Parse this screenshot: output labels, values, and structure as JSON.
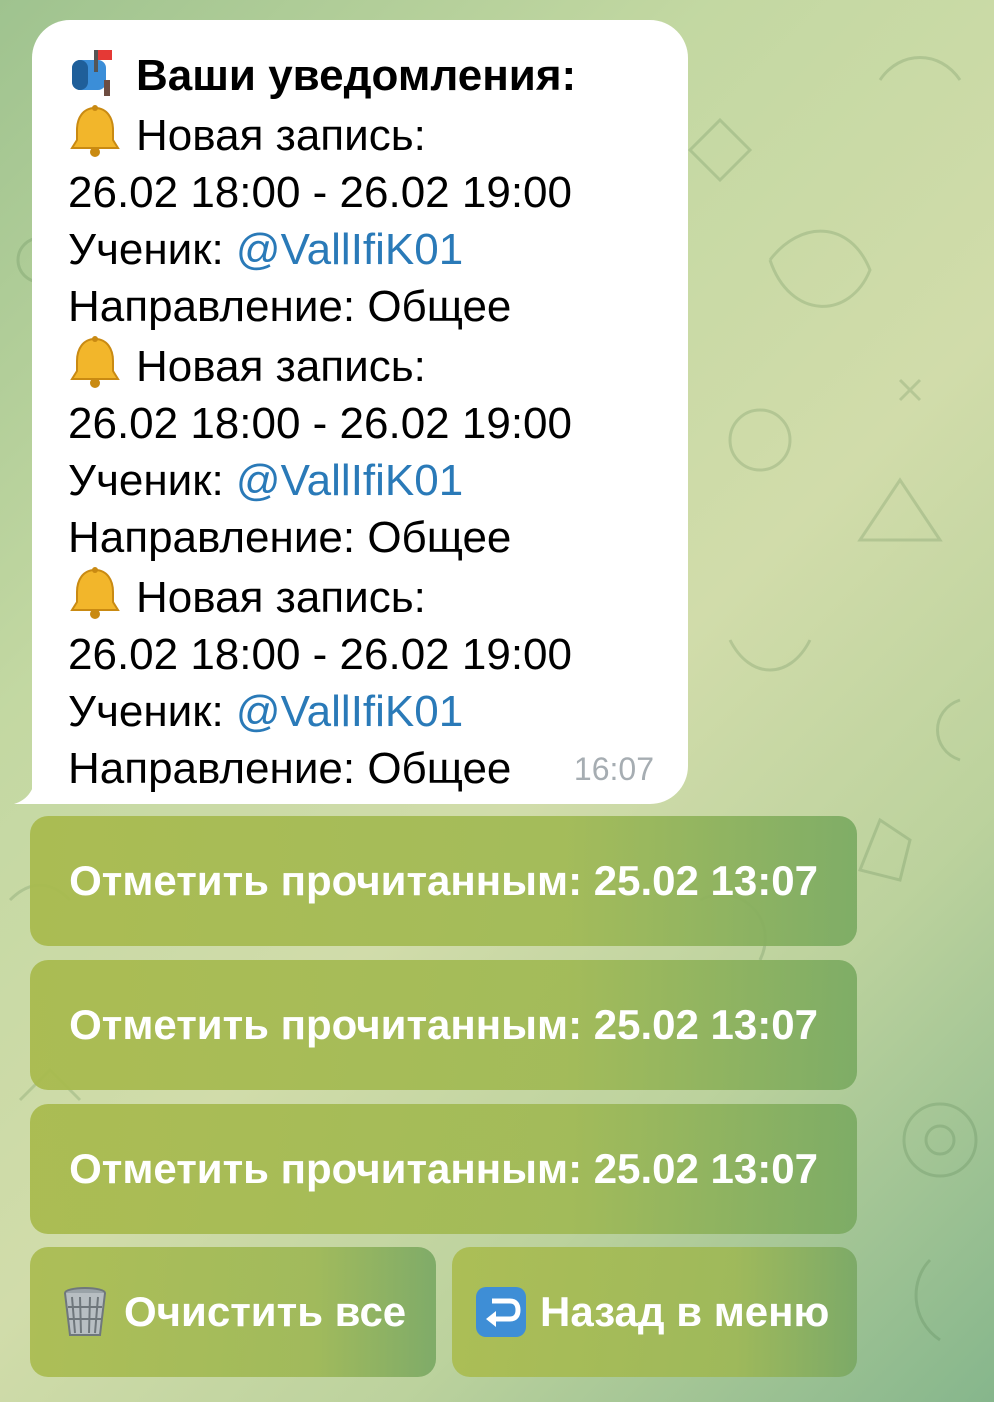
{
  "message": {
    "title": "Ваши уведомления:",
    "title_icon": "mailbox-icon",
    "entries": [
      {
        "icon": "bell-icon",
        "heading": "Новая запись:",
        "time_range": "26.02 18:00 - 26.02 19:00",
        "student_label": "Ученик: ",
        "student_handle": "@VallIfiK01",
        "direction": "Направление: Общее"
      },
      {
        "icon": "bell-icon",
        "heading": "Новая запись:",
        "time_range": "26.02 18:00 - 26.02 19:00",
        "student_label": "Ученик: ",
        "student_handle": "@VallIfiK01",
        "direction": "Направление: Общее"
      },
      {
        "icon": "bell-icon",
        "heading": "Новая запись:",
        "time_range": "26.02 18:00 - 26.02 19:00",
        "student_label": "Ученик: ",
        "student_handle": "@VallIfiK01",
        "direction": "Направление: Общее"
      }
    ],
    "time": "16:07"
  },
  "keyboard": {
    "mark_read_buttons": [
      "Отметить прочитанным: 25.02 13:07",
      "Отметить прочитанным: 25.02 13:07",
      "Отметить прочитанным: 25.02 13:07"
    ],
    "clear_all": {
      "label": "Очистить все",
      "icon": "wastebasket-icon"
    },
    "back_to_menu": {
      "label": "Назад в меню",
      "icon": "return-arrow-icon"
    }
  },
  "colors": {
    "link": "#2a7ab8",
    "timestamp": "#a6adb2",
    "button_text": "#ffffff"
  }
}
